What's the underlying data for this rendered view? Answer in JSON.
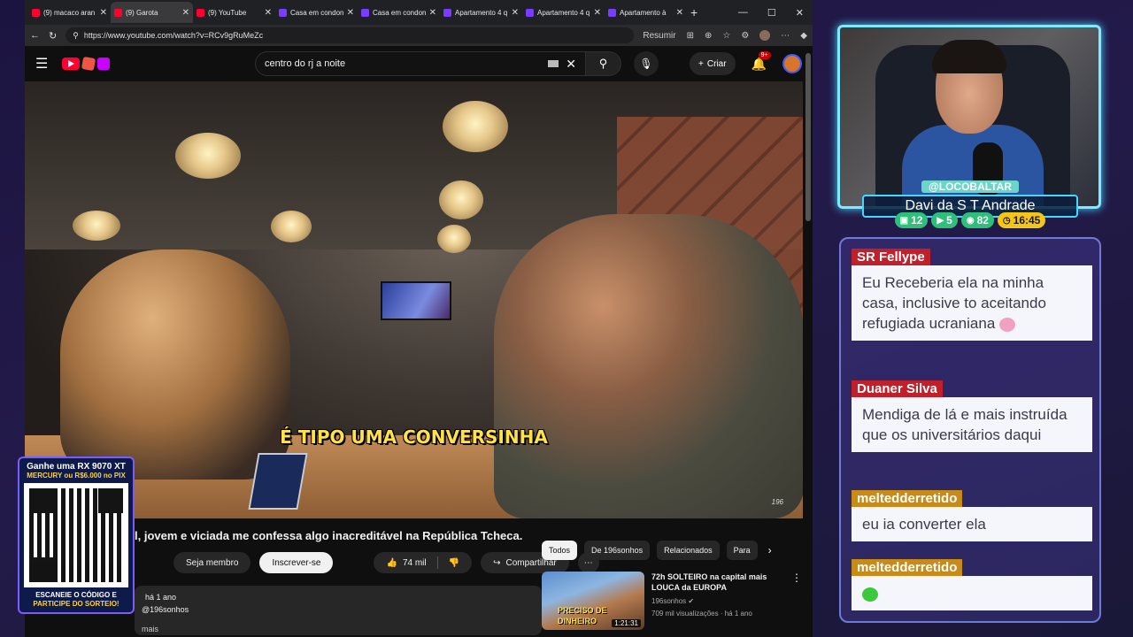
{
  "browser": {
    "tabs": [
      {
        "label": "(9) macaco aran",
        "icon": "youtube-favicon"
      },
      {
        "label": "(9) Garota",
        "icon": "youtube-favicon",
        "active": true
      },
      {
        "label": "(9) YouTube",
        "icon": "youtube-favicon"
      },
      {
        "label": "Casa em condon",
        "icon": "site-favicon"
      },
      {
        "label": "Casa em condon",
        "icon": "site-favicon"
      },
      {
        "label": "Apartamento 4 q",
        "icon": "site-favicon"
      },
      {
        "label": "Apartamento 4 q",
        "icon": "site-favicon"
      },
      {
        "label": "Apartamento à",
        "icon": "site-favicon"
      }
    ],
    "url": "https://www.youtube.com/watch?v=RCv9gRuMeZc",
    "resumir": "Resumir"
  },
  "youtube": {
    "search_value": "centro do rj a noite",
    "criar": "Criar",
    "notif_count": "9+",
    "video": {
      "caption": "É TIPO UMA CONVERSINHA",
      "watermark": "196",
      "title": "l, jovem e viciada me confessa algo inacreditável na República Tcheca.",
      "member_btn": "Seja membro",
      "subscribe_btn": "Inscrever-se",
      "likes": "74 mil",
      "share": "Compartilhar",
      "time_ago": "há 1 ano",
      "channel_handle": "@196sonhos",
      "more": "mais"
    },
    "chips": [
      "Todos",
      "De 196sonhos",
      "Relacionados",
      "Para"
    ],
    "recommended": {
      "title": "72h SOLTEIRO na capital mais LOUCA da EUROPA",
      "channel": "196sonhos",
      "views": "709 mil visualizações · há 1 ano",
      "duration": "1:21:31",
      "thumb_text": "PRECISO DE DINHEIRO"
    }
  },
  "promo": {
    "line1": "Ganhe uma RX 9070 XT",
    "line2": "MERCURY ou R$6.000 no PIX",
    "line3": "ESCANEIE O CÓDIGO E",
    "line4": "PARTICIPE DO SORTEIO!"
  },
  "stream": {
    "handle": "@LOCOBALTAR",
    "name": "Davi da S T Andrade",
    "stats": {
      "chat": "12",
      "yt": "5",
      "kick": "82",
      "time": "16:45"
    }
  },
  "chat": [
    {
      "author": "SR Fellype",
      "text": "Eu Receberia ela na minha casa, inclusive to aceitando refugiada ucraniana",
      "color": "#c0202a"
    },
    {
      "author": "Duaner Silva",
      "text": "Mendiga de lá e mais instruída que os universitários daqui",
      "color": "#c0202a"
    },
    {
      "author": "meltedderretido",
      "text": "eu ia converter ela",
      "color": "#c88a18"
    },
    {
      "author": "meltedderretido",
      "text": "",
      "color": "#c88a18"
    }
  ]
}
